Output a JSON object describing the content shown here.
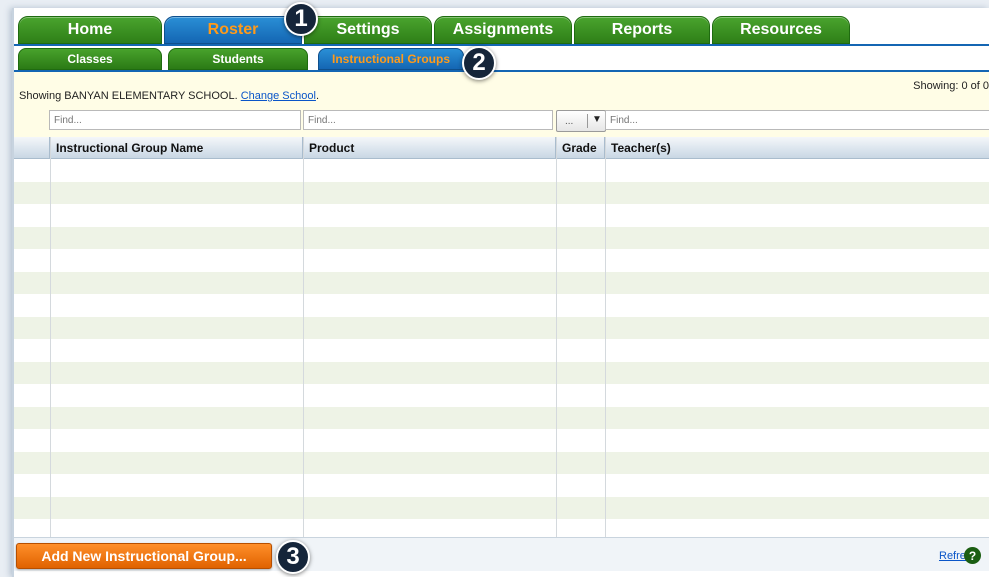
{
  "main_tabs": [
    {
      "label": "Home",
      "active": false
    },
    {
      "label": "Roster",
      "active": true
    },
    {
      "label": "Settings",
      "active": false
    },
    {
      "label": "Assignments",
      "active": false
    },
    {
      "label": "Reports",
      "active": false
    },
    {
      "label": "Resources",
      "active": false
    }
  ],
  "sub_tabs": [
    {
      "label": "Classes",
      "active": false
    },
    {
      "label": "Students",
      "active": false
    },
    {
      "label": "Instructional Groups",
      "active": true
    }
  ],
  "info": {
    "school_prefix": "Showing BANYAN ELEMENTARY SCHOOL. ",
    "change_school_link": "Change School",
    "suffix": ".",
    "showing_count": "Showing: 0 of 0"
  },
  "filters": {
    "name_placeholder": "Find...",
    "product_placeholder": "Find...",
    "grade_value": "...",
    "teacher_placeholder": "Find..."
  },
  "grid": {
    "columns": [
      "Instructional Group Name",
      "Product",
      "Grade",
      "Teacher(s)"
    ],
    "rows": []
  },
  "footer": {
    "add_button": "Add New Instructional Group...",
    "refresh": "Refresh",
    "help": "?"
  },
  "callouts": [
    "1",
    "2",
    "3"
  ],
  "colors": {
    "tab_green": "#2e7f17",
    "tab_active_blue": "#1466b3",
    "active_text_orange": "#ff9a1a",
    "info_bg": "#fffde6",
    "add_button_orange": "#e06200"
  }
}
